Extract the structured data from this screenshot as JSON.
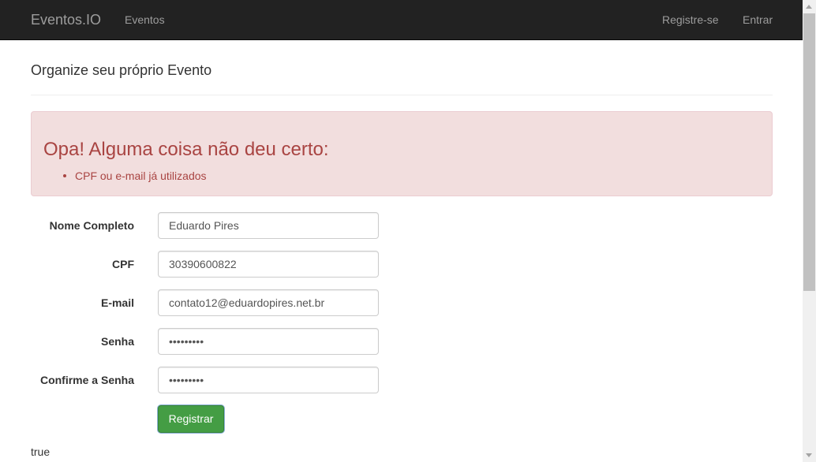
{
  "navbar": {
    "brand": "Eventos.IO",
    "eventos": "Eventos",
    "registre": "Registre-se",
    "entrar": "Entrar"
  },
  "heading": "Organize seu próprio Evento",
  "alert": {
    "title": "Opa! Alguma coisa não deu certo:",
    "errors": [
      "CPF ou e-mail já utilizados"
    ]
  },
  "form": {
    "nome": {
      "label": "Nome Completo",
      "value": "Eduardo Pires"
    },
    "cpf": {
      "label": "CPF",
      "value": "30390600822"
    },
    "email": {
      "label": "E-mail",
      "value": "contato12@eduardopires.net.br"
    },
    "senha": {
      "label": "Senha",
      "value": "•••••••••"
    },
    "confirme": {
      "label": "Confirme a Senha",
      "value": "•••••••••"
    },
    "submit": "Registrar"
  },
  "footer_text": "true",
  "colors": {
    "navbar_bg": "#222222",
    "alert_bg": "#f2dede",
    "alert_text": "#a94442",
    "button_bg": "#449d44"
  }
}
